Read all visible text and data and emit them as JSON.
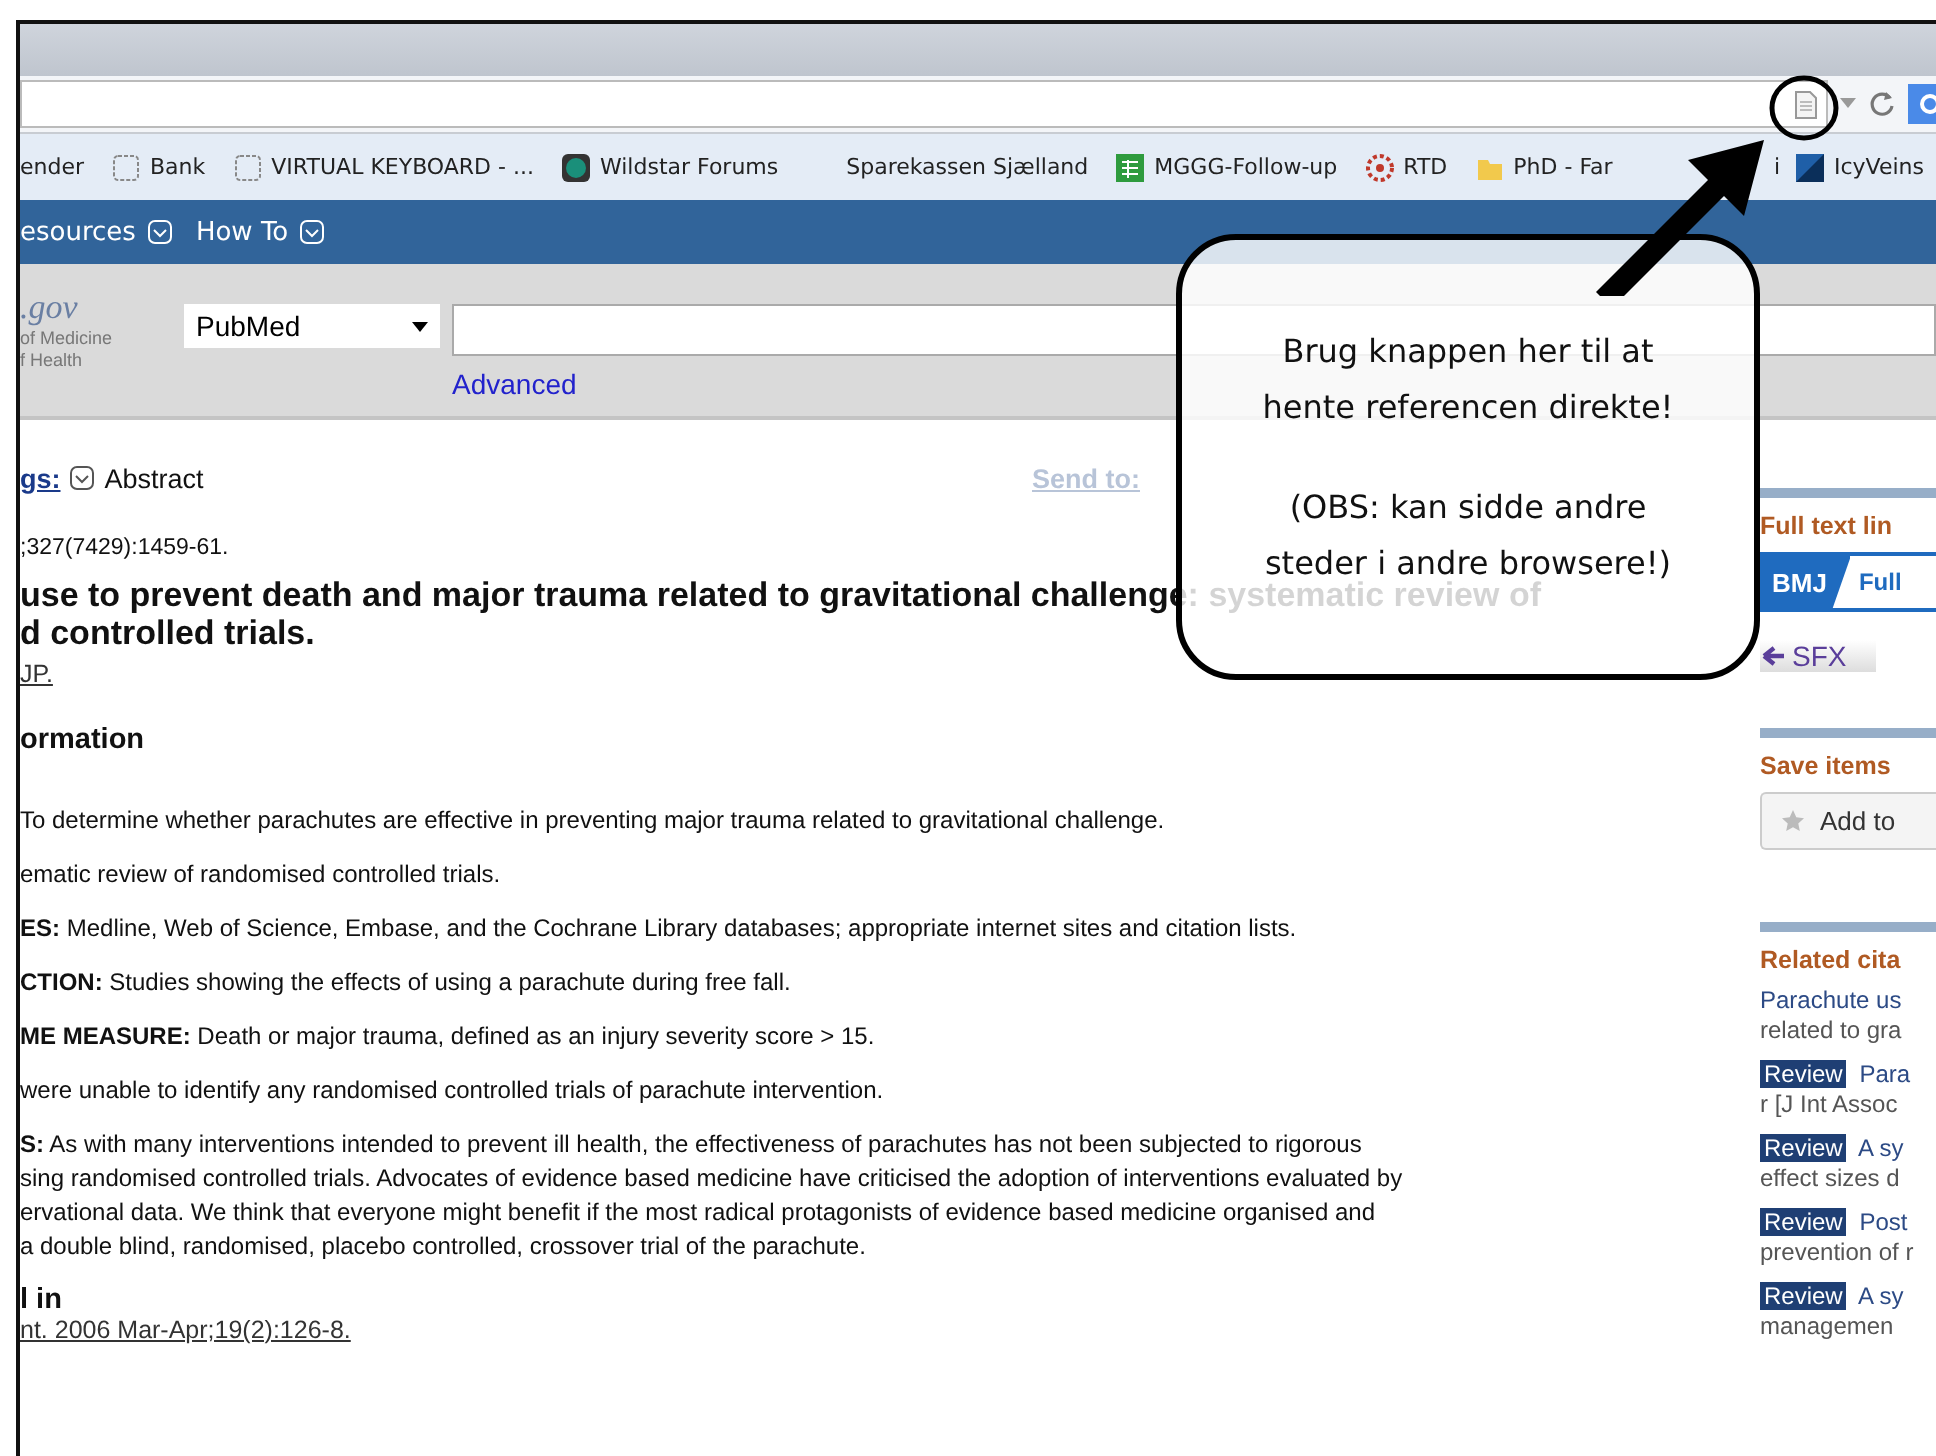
{
  "bookmarks": [
    {
      "label": "ender",
      "kind": "plain"
    },
    {
      "label": "Bank",
      "kind": "blank"
    },
    {
      "label": "VIRTUAL KEYBOARD - ...",
      "kind": "blank"
    },
    {
      "label": "Wildstar Forums",
      "kind": "circle"
    },
    {
      "label": "Sparekassen Sjælland",
      "kind": "plain"
    },
    {
      "label": "MGGG-Follow-up",
      "kind": "sheet"
    },
    {
      "label": "RTD",
      "kind": "burst"
    },
    {
      "label": "PhD - Far",
      "kind": "folder"
    },
    {
      "label": "i",
      "kind": "plain"
    },
    {
      "label": "IcyVeins",
      "kind": "tile"
    }
  ],
  "nav": [
    {
      "label": "esources"
    },
    {
      "label": "How To"
    }
  ],
  "search": {
    "logo": ".gov",
    "logo_lines": [
      "of Medicine",
      "f Health"
    ],
    "database": "PubMed",
    "advanced": "Advanced"
  },
  "article": {
    "format_link": "gs:",
    "format": "Abstract",
    "send_to": "Send to:",
    "citation": ";327(7429):1459-61.",
    "title_lines": [
      "use to prevent death and major trauma related to gravitational challenge: systematic review of",
      "d controlled trials."
    ],
    "author": "JP.",
    "info_heading": "ormation",
    "abstract": [
      {
        "lines": [
          "To determine whether parachutes are effective in preventing major trauma related to gravitational challenge."
        ]
      },
      {
        "lines": [
          "ematic review of randomised controlled trials."
        ]
      },
      {
        "lines": [
          "**ES:** Medline, Web of Science, Embase, and the Cochrane Library databases; appropriate internet sites and citation lists."
        ]
      },
      {
        "lines": [
          "**CTION:** Studies showing the effects of using a parachute during free fall."
        ]
      },
      {
        "lines": [
          "**ME MEASURE:** Death or major trauma, defined as an injury severity score > 15."
        ]
      },
      {
        "lines": [
          "were unable to identify any randomised controlled trials of parachute intervention."
        ]
      },
      {
        "lines": [
          "**S:** As with many interventions intended to prevent ill health, the effectiveness of parachutes has not been subjected to rigorous",
          "sing randomised controlled trials. Advocates of evidence based medicine have criticised the adoption of interventions evaluated by",
          "ervational data. We think that everyone might benefit if the most radical protagonists of evidence based medicine organised and",
          "a double blind, randomised, placebo controlled, crossover trial of the parachute."
        ]
      }
    ],
    "cited_heading": "l in",
    "cited_link": "nt. 2006 Mar-Apr;19(2):126-8."
  },
  "sidebar": {
    "full_text_heading": "Full text lin",
    "bmj": "BMJ",
    "full": "Full",
    "sfx": "SFX",
    "save_heading": "Save items",
    "add_button": "Add to",
    "related_heading": "Related cita",
    "related": [
      {
        "lines": [
          "Parachute us",
          "related to gra"
        ]
      },
      {
        "badge": "Review",
        "lines": [
          "Para",
          "r [J Int Assoc"
        ]
      },
      {
        "badge": "Review",
        "lines": [
          "A sy",
          "effect sizes d"
        ]
      },
      {
        "badge": "Review",
        "lines": [
          "Post",
          "prevention of r"
        ]
      },
      {
        "badge": "Review",
        "lines": [
          "A sy",
          "managemen"
        ]
      }
    ]
  },
  "callout": {
    "paragraphs": [
      "Brug knappen her til at hente referencen direkte!",
      "(OBS: kan sidde andre steder i andre browsere!)"
    ]
  }
}
